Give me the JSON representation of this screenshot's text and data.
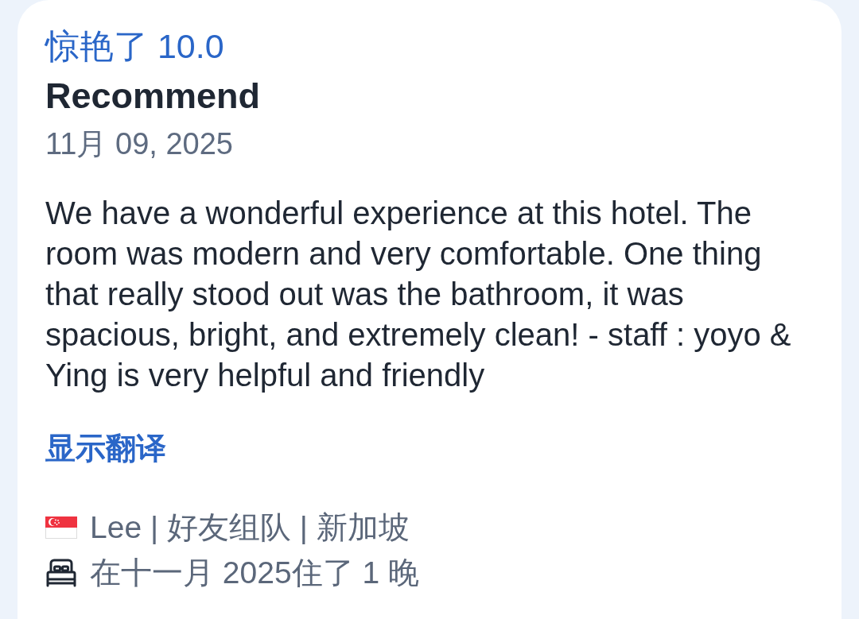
{
  "review": {
    "rating_label": "惊艳了 10.0",
    "title": "Recommend",
    "date": "11月 09, 2025",
    "body": "We have a wonderful experience at this hotel. The room was modern and very comfortable. One thing that really stood out was the bathroom, it was spacious, bright, and extremely clean! - staff : yoyo & Ying is very helpful and friendly",
    "translate_link": "显示翻译",
    "meta": [
      {
        "kind": "reviewer",
        "text": "Lee | 好友组队 | 新加坡"
      },
      {
        "kind": "stay",
        "text": "在十一月 2025住了 1 晚"
      }
    ]
  }
}
